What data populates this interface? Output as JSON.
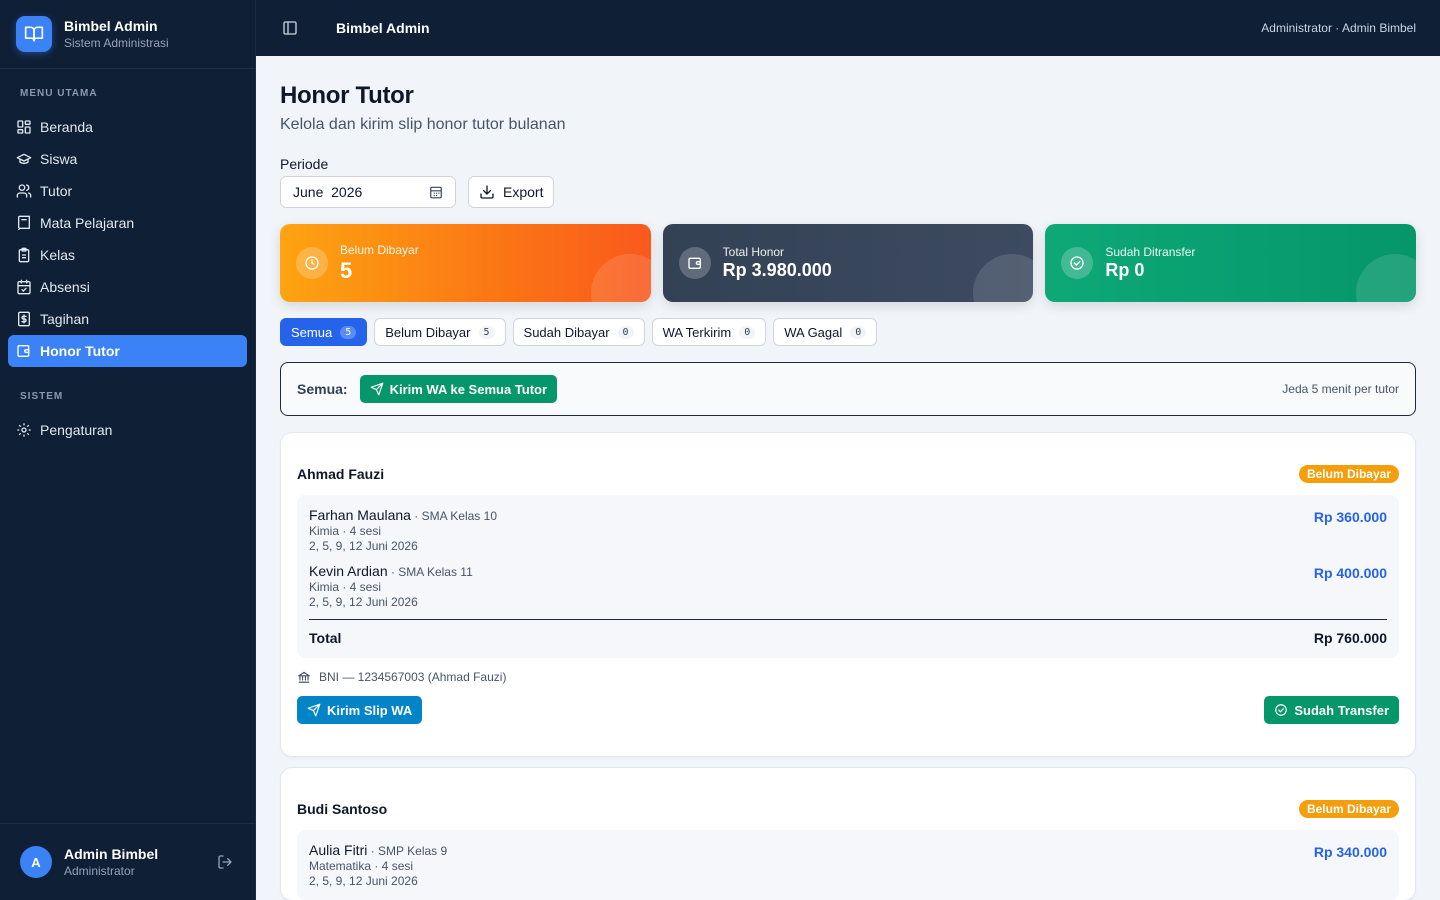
{
  "brand": {
    "title": "Bimbel Admin",
    "subtitle": "Sistem Administrasi"
  },
  "sidebar": {
    "section_main": "MENU UTAMA",
    "section_system": "SISTEM",
    "items": [
      {
        "label": "Beranda",
        "icon": "dashboard-icon"
      },
      {
        "label": "Siswa",
        "icon": "graduation-cap-icon"
      },
      {
        "label": "Tutor",
        "icon": "users-icon"
      },
      {
        "label": "Mata Pelajaran",
        "icon": "book-icon"
      },
      {
        "label": "Kelas",
        "icon": "clipboard-icon"
      },
      {
        "label": "Absensi",
        "icon": "calendar-check-icon"
      },
      {
        "label": "Tagihan",
        "icon": "receipt-icon"
      },
      {
        "label": "Honor Tutor",
        "icon": "wallet-icon",
        "active": true
      }
    ],
    "system_items": [
      {
        "label": "Pengaturan",
        "icon": "gear-icon"
      }
    ],
    "user": {
      "initial": "A",
      "name": "Admin Bimbel",
      "role": "Administrator"
    }
  },
  "topbar": {
    "title": "Bimbel Admin",
    "user": "Administrator · Admin Bimbel"
  },
  "page": {
    "title": "Honor Tutor",
    "subtitle": "Kelola dan kirim slip honor tutor bulanan",
    "periode_label": "Periode",
    "periode_value": "June  2026",
    "export_label": "Export"
  },
  "stats": [
    {
      "label": "Belum Dibayar",
      "value": "5"
    },
    {
      "label": "Total Honor",
      "value": "Rp 3.980.000"
    },
    {
      "label": "Sudah Ditransfer",
      "value": "Rp 0"
    }
  ],
  "filters": [
    {
      "label": "Semua",
      "count": "5",
      "active": true
    },
    {
      "label": "Belum Dibayar",
      "count": "5"
    },
    {
      "label": "Sudah Dibayar",
      "count": "0"
    },
    {
      "label": "WA Terkirim",
      "count": "0"
    },
    {
      "label": "WA Gagal",
      "count": "0"
    }
  ],
  "bulk": {
    "label": "Semua:",
    "button": "Kirim WA ke Semua Tutor",
    "note": "Jeda 5 menit per tutor"
  },
  "tutors": [
    {
      "name": "Ahmad Fauzi",
      "status": "Belum Dibayar",
      "items": [
        {
          "student": "Farhan Maulana",
          "class": " · SMA Kelas 10",
          "subject": "Kimia · 4 sesi",
          "dates": "2, 5, 9, 12 Juni 2026",
          "amount": "Rp 360.000"
        },
        {
          "student": "Kevin Ardian",
          "class": " · SMA Kelas 11",
          "subject": "Kimia · 4 sesi",
          "dates": "2, 5, 9, 12 Juni 2026",
          "amount": "Rp 400.000"
        }
      ],
      "total_label": "Total",
      "total": "Rp 760.000",
      "bank": "BNI — 1234567003 (Ahmad Fauzi)",
      "send_label": "Kirim Slip WA",
      "transfer_label": "Sudah Transfer"
    },
    {
      "name": "Budi Santoso",
      "status": "Belum Dibayar",
      "items": [
        {
          "student": "Aulia Fitri",
          "class": " · SMP Kelas 9",
          "subject": "Matematika · 4 sesi",
          "dates": "2, 5, 9, 12 Juni 2026",
          "amount": "Rp 340.000"
        }
      ]
    }
  ],
  "colors": {
    "sidebar_bg": "#0f1f35",
    "accent": "#3b82f6",
    "warning": "#f59e0b",
    "success": "#059669",
    "amount": "#2563eb"
  }
}
